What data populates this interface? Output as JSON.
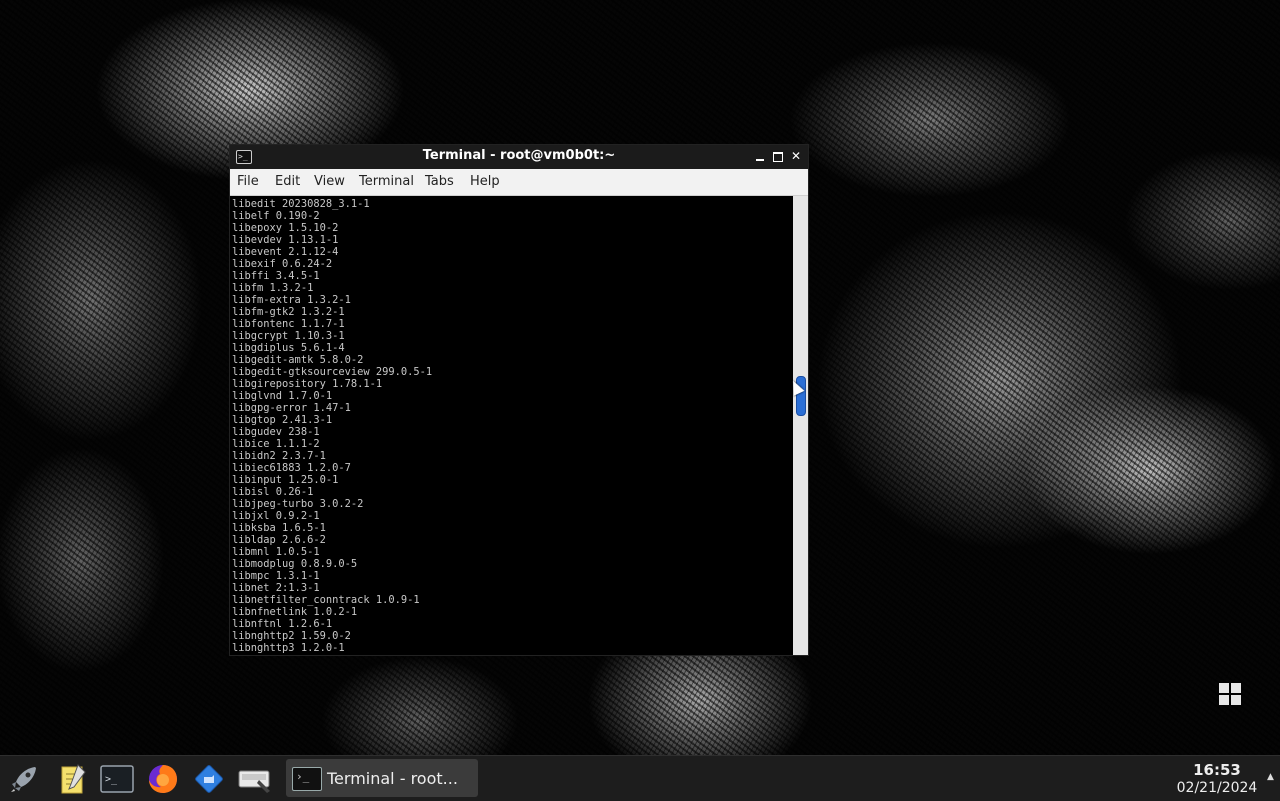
{
  "window": {
    "title": "Terminal - root@vm0b0t:~",
    "menu": [
      "File",
      "Edit",
      "View",
      "Terminal",
      "Tabs",
      "Help"
    ]
  },
  "terminal": {
    "lines": [
      "libedit 20230828_3.1-1",
      "libelf 0.190-2",
      "libepoxy 1.5.10-2",
      "libevdev 1.13.1-1",
      "libevent 2.1.12-4",
      "libexif 0.6.24-2",
      "libffi 3.4.5-1",
      "libfm 1.3.2-1",
      "libfm-extra 1.3.2-1",
      "libfm-gtk2 1.3.2-1",
      "libfontenc 1.1.7-1",
      "libgcrypt 1.10.3-1",
      "libgdiplus 5.6.1-4",
      "libgedit-amtk 5.8.0-2",
      "libgedit-gtksourceview 299.0.5-1",
      "libgirepository 1.78.1-1",
      "libglvnd 1.7.0-1",
      "libgpg-error 1.47-1",
      "libgtop 2.41.3-1",
      "libgudev 238-1",
      "libice 1.1.1-2",
      "libidn2 2.3.7-1",
      "libiec61883 1.2.0-7",
      "libinput 1.25.0-1",
      "libisl 0.26-1",
      "libjpeg-turbo 3.0.2-2",
      "libjxl 0.9.2-1",
      "libksba 1.6.5-1",
      "libldap 2.6.6-2",
      "libmnl 1.0.5-1",
      "libmodplug 0.8.9.0-5",
      "libmpc 1.3.1-1",
      "libnet 2:1.3-1",
      "libnetfilter_conntrack 1.0.9-1",
      "libnfnetlink 1.0.2-1",
      "libnftnl 1.2.6-1",
      "libnghttp2 1.59.0-2",
      "libnghttp3 1.2.0-1"
    ]
  },
  "taskbar": {
    "launchers": [
      {
        "name": "rocket-icon"
      },
      {
        "name": "text-editor-icon"
      },
      {
        "name": "terminal-icon"
      },
      {
        "name": "firefox-icon"
      },
      {
        "name": "files-icon"
      },
      {
        "name": "screenshot-icon"
      }
    ],
    "task_label": "Terminal - root...",
    "clock": {
      "time": "16:53",
      "date": "02/21/2024"
    }
  },
  "colors": {
    "scroll_thumb": "#2b6fd6",
    "terminal_bg": "#000000",
    "terminal_fg": "#c8c8c8",
    "taskbar_bg": "#1d1d1d"
  }
}
